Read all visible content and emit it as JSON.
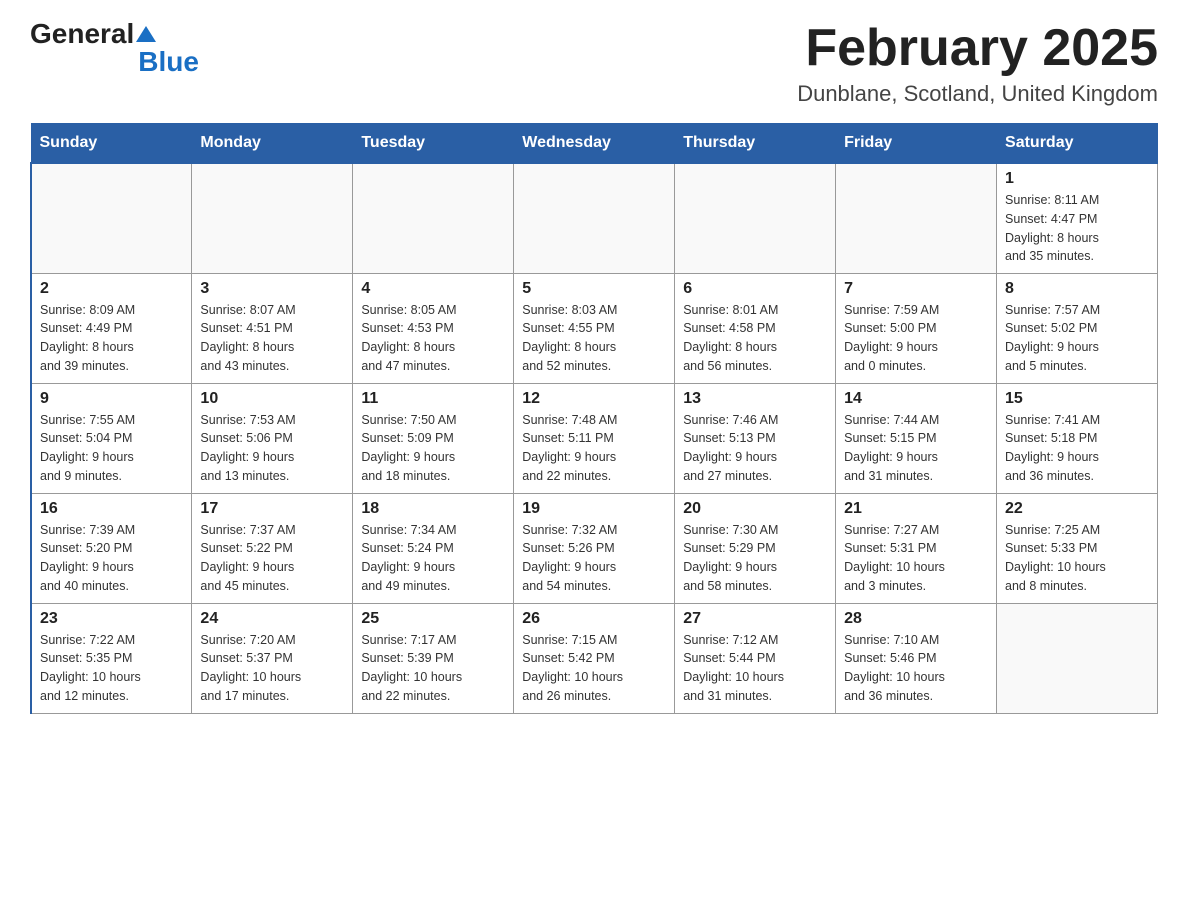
{
  "header": {
    "logo_general": "General",
    "logo_blue": "Blue",
    "month_title": "February 2025",
    "location": "Dunblane, Scotland, United Kingdom"
  },
  "days_of_week": [
    "Sunday",
    "Monday",
    "Tuesday",
    "Wednesday",
    "Thursday",
    "Friday",
    "Saturday"
  ],
  "weeks": [
    [
      {
        "day": "",
        "info": ""
      },
      {
        "day": "",
        "info": ""
      },
      {
        "day": "",
        "info": ""
      },
      {
        "day": "",
        "info": ""
      },
      {
        "day": "",
        "info": ""
      },
      {
        "day": "",
        "info": ""
      },
      {
        "day": "1",
        "info": "Sunrise: 8:11 AM\nSunset: 4:47 PM\nDaylight: 8 hours\nand 35 minutes."
      }
    ],
    [
      {
        "day": "2",
        "info": "Sunrise: 8:09 AM\nSunset: 4:49 PM\nDaylight: 8 hours\nand 39 minutes."
      },
      {
        "day": "3",
        "info": "Sunrise: 8:07 AM\nSunset: 4:51 PM\nDaylight: 8 hours\nand 43 minutes."
      },
      {
        "day": "4",
        "info": "Sunrise: 8:05 AM\nSunset: 4:53 PM\nDaylight: 8 hours\nand 47 minutes."
      },
      {
        "day": "5",
        "info": "Sunrise: 8:03 AM\nSunset: 4:55 PM\nDaylight: 8 hours\nand 52 minutes."
      },
      {
        "day": "6",
        "info": "Sunrise: 8:01 AM\nSunset: 4:58 PM\nDaylight: 8 hours\nand 56 minutes."
      },
      {
        "day": "7",
        "info": "Sunrise: 7:59 AM\nSunset: 5:00 PM\nDaylight: 9 hours\nand 0 minutes."
      },
      {
        "day": "8",
        "info": "Sunrise: 7:57 AM\nSunset: 5:02 PM\nDaylight: 9 hours\nand 5 minutes."
      }
    ],
    [
      {
        "day": "9",
        "info": "Sunrise: 7:55 AM\nSunset: 5:04 PM\nDaylight: 9 hours\nand 9 minutes."
      },
      {
        "day": "10",
        "info": "Sunrise: 7:53 AM\nSunset: 5:06 PM\nDaylight: 9 hours\nand 13 minutes."
      },
      {
        "day": "11",
        "info": "Sunrise: 7:50 AM\nSunset: 5:09 PM\nDaylight: 9 hours\nand 18 minutes."
      },
      {
        "day": "12",
        "info": "Sunrise: 7:48 AM\nSunset: 5:11 PM\nDaylight: 9 hours\nand 22 minutes."
      },
      {
        "day": "13",
        "info": "Sunrise: 7:46 AM\nSunset: 5:13 PM\nDaylight: 9 hours\nand 27 minutes."
      },
      {
        "day": "14",
        "info": "Sunrise: 7:44 AM\nSunset: 5:15 PM\nDaylight: 9 hours\nand 31 minutes."
      },
      {
        "day": "15",
        "info": "Sunrise: 7:41 AM\nSunset: 5:18 PM\nDaylight: 9 hours\nand 36 minutes."
      }
    ],
    [
      {
        "day": "16",
        "info": "Sunrise: 7:39 AM\nSunset: 5:20 PM\nDaylight: 9 hours\nand 40 minutes."
      },
      {
        "day": "17",
        "info": "Sunrise: 7:37 AM\nSunset: 5:22 PM\nDaylight: 9 hours\nand 45 minutes."
      },
      {
        "day": "18",
        "info": "Sunrise: 7:34 AM\nSunset: 5:24 PM\nDaylight: 9 hours\nand 49 minutes."
      },
      {
        "day": "19",
        "info": "Sunrise: 7:32 AM\nSunset: 5:26 PM\nDaylight: 9 hours\nand 54 minutes."
      },
      {
        "day": "20",
        "info": "Sunrise: 7:30 AM\nSunset: 5:29 PM\nDaylight: 9 hours\nand 58 minutes."
      },
      {
        "day": "21",
        "info": "Sunrise: 7:27 AM\nSunset: 5:31 PM\nDaylight: 10 hours\nand 3 minutes."
      },
      {
        "day": "22",
        "info": "Sunrise: 7:25 AM\nSunset: 5:33 PM\nDaylight: 10 hours\nand 8 minutes."
      }
    ],
    [
      {
        "day": "23",
        "info": "Sunrise: 7:22 AM\nSunset: 5:35 PM\nDaylight: 10 hours\nand 12 minutes."
      },
      {
        "day": "24",
        "info": "Sunrise: 7:20 AM\nSunset: 5:37 PM\nDaylight: 10 hours\nand 17 minutes."
      },
      {
        "day": "25",
        "info": "Sunrise: 7:17 AM\nSunset: 5:39 PM\nDaylight: 10 hours\nand 22 minutes."
      },
      {
        "day": "26",
        "info": "Sunrise: 7:15 AM\nSunset: 5:42 PM\nDaylight: 10 hours\nand 26 minutes."
      },
      {
        "day": "27",
        "info": "Sunrise: 7:12 AM\nSunset: 5:44 PM\nDaylight: 10 hours\nand 31 minutes."
      },
      {
        "day": "28",
        "info": "Sunrise: 7:10 AM\nSunset: 5:46 PM\nDaylight: 10 hours\nand 36 minutes."
      },
      {
        "day": "",
        "info": ""
      }
    ]
  ]
}
